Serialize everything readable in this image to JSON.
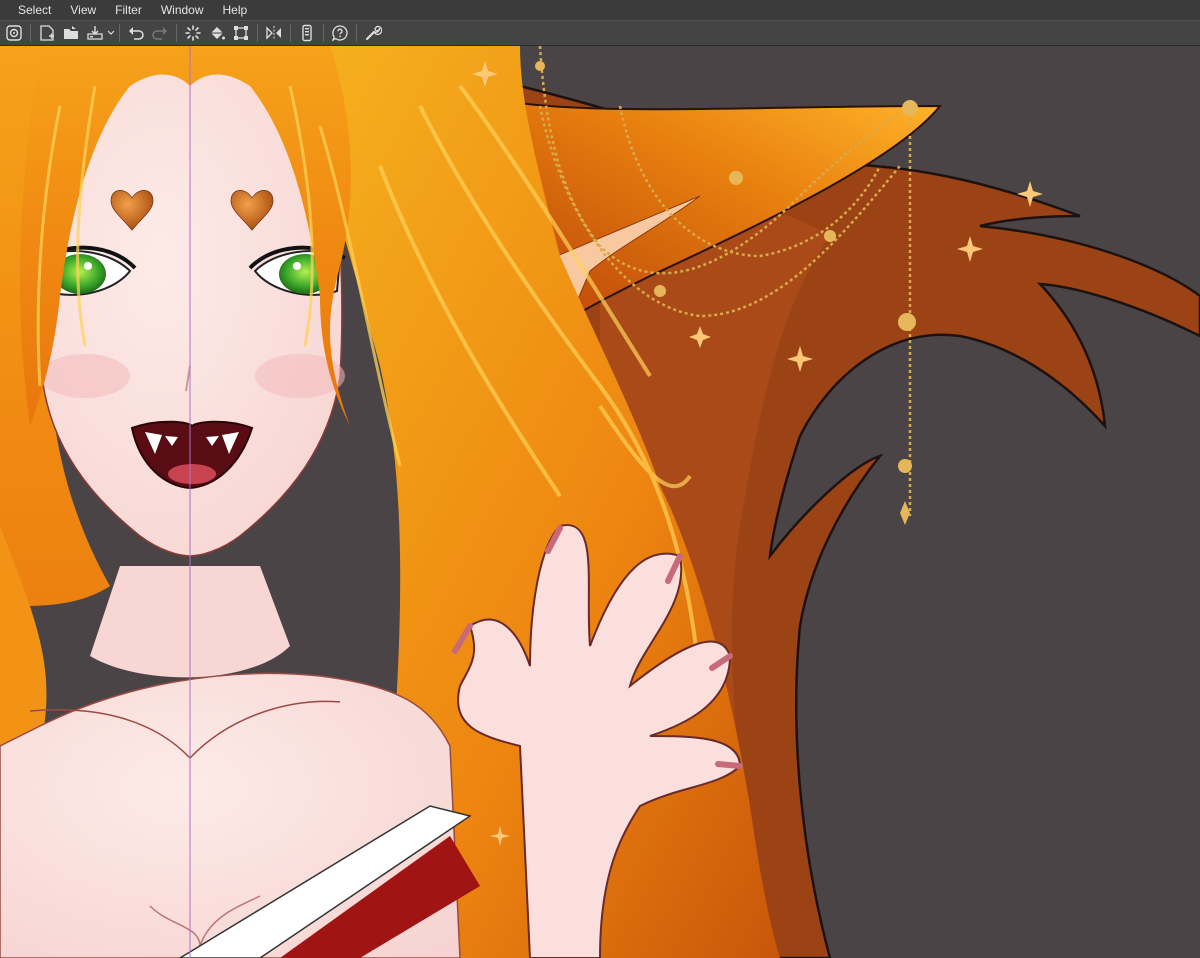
{
  "menubar": {
    "items": [
      "Select",
      "View",
      "Filter",
      "Window",
      "Help"
    ]
  },
  "toolbar": {
    "icons": [
      "app-menu-icon",
      "new-canvas-icon",
      "open-folder-icon",
      "save-icon",
      "undo-icon",
      "redo-icon",
      "loading-spinner-icon",
      "fill-icon",
      "transform-icon",
      "flip-horizontal-icon",
      "phone-link-icon",
      "help-icon",
      "settings-wrench-icon"
    ]
  },
  "colors": {
    "background": "#4b4446",
    "menubar": "#3b3b3b",
    "toolbar": "#444444",
    "hair": "#f08a12",
    "skin": "#fbe1de",
    "tail": "#9c4316",
    "gold": "#e6b75a",
    "guide_line": "#b070d0"
  }
}
